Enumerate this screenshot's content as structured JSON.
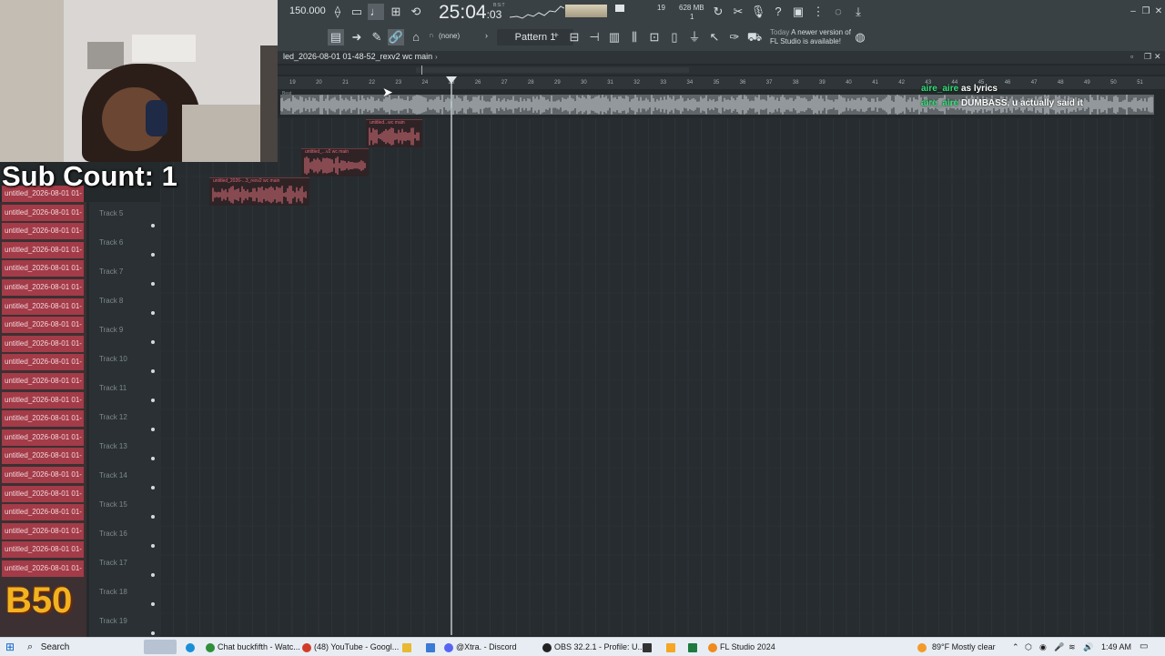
{
  "toolbar": {
    "tempo": "150.000",
    "clock_main": "25:04",
    "clock_sub": ":03",
    "clock_bst": "B:S:T",
    "memory_mb": "628 MB",
    "memory_voices": "19",
    "memory_cpu": "1",
    "pattern": "Pattern 1",
    "snap": "(none)",
    "news_day": "Today",
    "news_text": "A newer version of FL Studio is available!"
  },
  "playlist": {
    "title": "led_2026-08-01 01-48-52_rexv2 wc main",
    "ruler_ticks": [
      "19",
      "20",
      "21",
      "22",
      "23",
      "24",
      "25",
      "26",
      "27",
      "28",
      "29",
      "30",
      "31",
      "32",
      "33",
      "34",
      "35",
      "36",
      "37",
      "38",
      "39",
      "40",
      "41",
      "42",
      "43",
      "44",
      "45",
      "46",
      "47",
      "48",
      "49",
      "50",
      "51"
    ],
    "ruler_left_label": "Beat",
    "tracks": [
      "Track 5",
      "Track 6",
      "Track 7",
      "Track 8",
      "Track 9",
      "Track 10",
      "Track 11",
      "Track 12",
      "Track 13",
      "Track 14",
      "Track 15",
      "Track 16",
      "Track 17",
      "Track 18",
      "Track 19"
    ],
    "clips": [
      {
        "title": "untitled...wc main"
      },
      {
        "title": "untitled_...v2 wc main"
      },
      {
        "title": "untitled_2026-...3_rexv2 wc main"
      }
    ]
  },
  "clip_browser": {
    "items": [
      "untitled_2026-08-01 01-",
      "untitled_2026-08-01 01-",
      "untitled_2026-08-01 01-",
      "untitled_2026-08-01 01-",
      "untitled_2026-08-01 01-",
      "untitled_2026-08-01 01-",
      "untitled_2026-08-01 01-",
      "untitled_2026-08-01 01-",
      "untitled_2026-08-01 01-",
      "untitled_2026-08-01 01-",
      "untitled_2026-08-01 01-",
      "untitled_2026-08-01 01-",
      "untitled_2026-08-01 01-",
      "untitled_2026-08-01 01-",
      "untitled_2026-08-01 01-",
      "untitled_2026-08-01 01-",
      "untitled_2026-08-01 01-",
      "untitled_2026-08-01 01-",
      "untitled_2026-08-01 01-",
      "untitled_2026-08-01 01-",
      "untitled_2026-08-01 01-"
    ]
  },
  "overlay": {
    "sub_count": "Sub Count: 1",
    "badge": "B50"
  },
  "chat": [
    {
      "user": "aire_aire",
      "message": "as lyrics"
    },
    {
      "user": "aire_aire",
      "message": "DUMBASS, u actually said it"
    }
  ],
  "taskbar": {
    "search": "Search",
    "apps": [
      {
        "label": "Chat buckfifth - Watc...",
        "icon": "chrome-icon",
        "color": "#2f8f3a"
      },
      {
        "label": "(48) YouTube - Googl...",
        "icon": "chrome-icon",
        "color": "#d23b2a"
      },
      {
        "label": "@Xtra. - Discord",
        "icon": "discord-icon",
        "color": "#5865f2"
      },
      {
        "label": "OBS 32.2.1 - Profile: U...",
        "icon": "obs-icon",
        "color": "#222222"
      },
      {
        "label": "FL Studio 2024",
        "icon": "fl-studio-icon",
        "color": "#f08a1c"
      }
    ],
    "weather": "89°F  Mostly clear",
    "time": "1:49 AM"
  },
  "colors": {
    "accent_clip": "#a33b48",
    "chat_user": "#35e07a",
    "badge": "#f2b321"
  }
}
